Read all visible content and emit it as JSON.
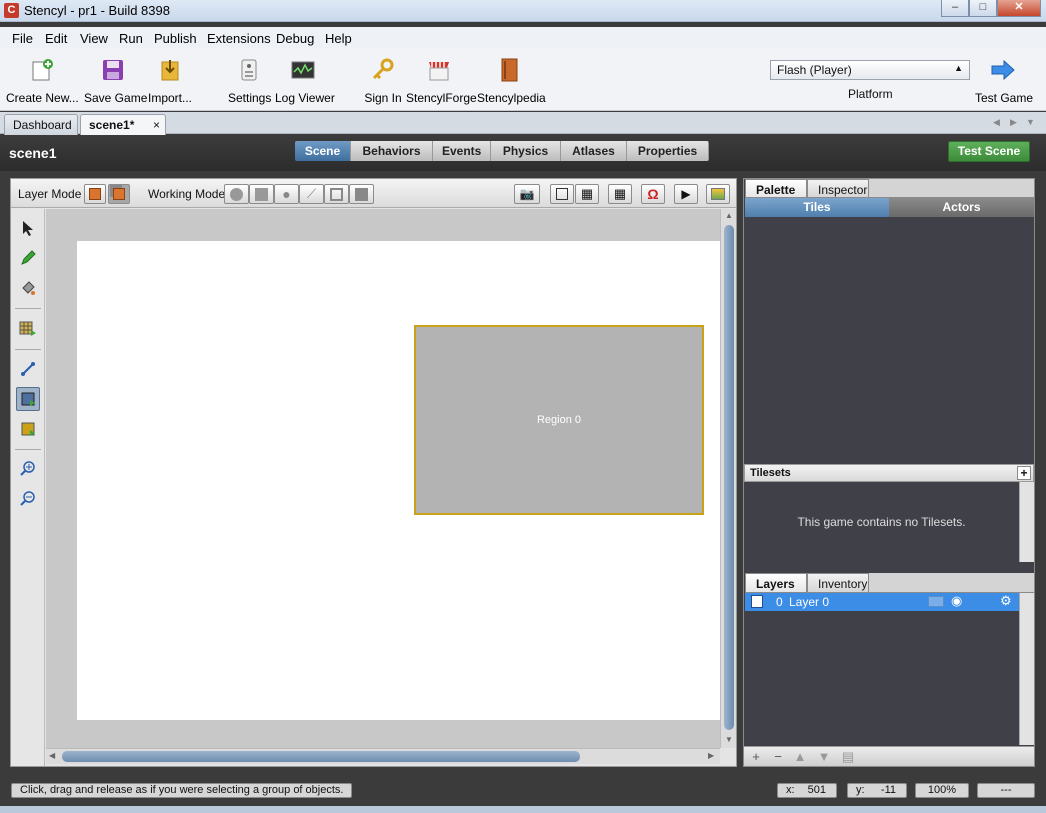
{
  "window": {
    "title": "Stencyl - pr1 - Build 8398",
    "app_icon_letter": "C",
    "minimize": "‒",
    "maximize": "□",
    "close": "✕"
  },
  "menu": [
    "File",
    "Edit",
    "View",
    "Run",
    "Publish",
    "Extensions",
    "Debug",
    "Help"
  ],
  "toolbar": {
    "buttons": [
      {
        "label": "Create New...",
        "icon": "create-new-icon"
      },
      {
        "label": "Save Game",
        "icon": "save-icon"
      },
      {
        "label": "Import...",
        "icon": "import-icon"
      },
      {
        "label": "Settings",
        "icon": "settings-icon"
      },
      {
        "label": "Log Viewer",
        "icon": "log-viewer-icon"
      },
      {
        "label": "Sign In",
        "icon": "key-icon"
      },
      {
        "label": "StencylForge",
        "icon": "store-icon"
      },
      {
        "label": "Stencylpedia",
        "icon": "book-icon"
      }
    ],
    "platform_value": "Flash (Player)",
    "platform_label": "Platform",
    "test_game_label": "Test Game"
  },
  "tabs": [
    {
      "label": "Dashboard"
    },
    {
      "label": "scene1*",
      "close": "×"
    }
  ],
  "scene": {
    "title": "scene1",
    "segments": [
      "Scene",
      "Behaviors",
      "Events",
      "Physics",
      "Atlases",
      "Properties"
    ],
    "active_segment": "Scene",
    "test_scene_label": "Test Scene"
  },
  "modebar": {
    "layer_mode_label": "Layer Mode",
    "working_mode_label": "Working Mode"
  },
  "canvas": {
    "region_label": "Region 0"
  },
  "palette": {
    "tabs": [
      "Palette",
      "Inspector"
    ],
    "subtabs": [
      "Tiles",
      "Actors"
    ],
    "tilesets_header": "Tilesets",
    "tilesets_empty": "This game contains no Tilesets.",
    "plus": "+"
  },
  "layers": {
    "tabs": [
      "Layers",
      "Inventory"
    ],
    "rows": [
      {
        "index": "0",
        "name": "Layer 0"
      }
    ],
    "footer": [
      "+",
      "−",
      "▲",
      "▼",
      "▤"
    ]
  },
  "status": {
    "message": "Click, drag and release as if you were selecting a group of objects.",
    "x_label": "x:",
    "x_value": "501",
    "y_label": "y:",
    "y_value": "-11",
    "zoom": "100%",
    "extra": "---"
  },
  "colors": {
    "accent_blue": "#3c8de6",
    "test_green": "#4a9c47",
    "region_border": "#c9a21a",
    "active_segment": "#4f7fae"
  }
}
